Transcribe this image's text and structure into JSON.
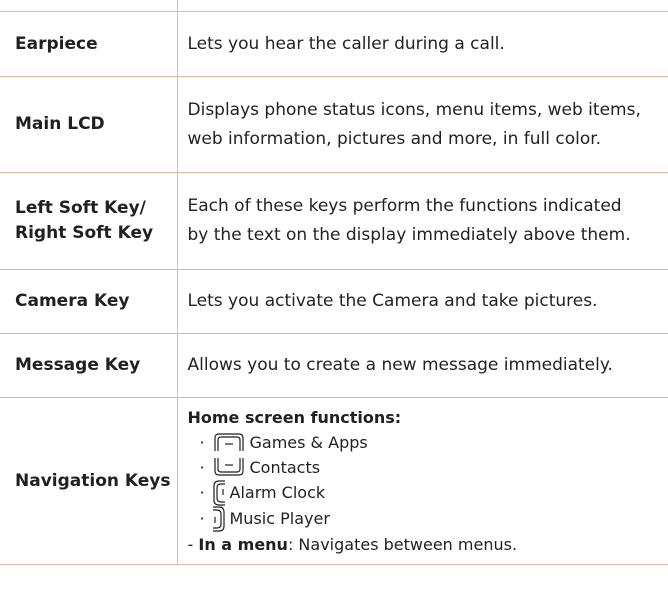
{
  "rows": [
    {
      "key": "Earpiece",
      "desc": "Lets you hear the caller during a call."
    },
    {
      "key": "Main LCD",
      "desc_lines": [
        "Displays phone status icons, menu items, web items,",
        "web information, pictures and more, in full color."
      ]
    },
    {
      "key_lines": [
        "Left Soft Key/",
        "Right Soft Key"
      ],
      "desc_lines": [
        "Each of these keys perform the functions indicated",
        "by the text on the display immediately above them."
      ]
    },
    {
      "key": "Camera Key",
      "desc": "Lets you activate the Camera and take pictures."
    },
    {
      "key": "Message Key",
      "desc": "Allows you to create a new message immediately."
    },
    {
      "key": "Navigation Keys",
      "heading": "Home screen functions:",
      "items": [
        {
          "bullet": "·",
          "icon": "nav-up-key-icon",
          "label": "Games & Apps"
        },
        {
          "bullet": "·",
          "icon": "nav-down-key-icon",
          "label": "Contacts"
        },
        {
          "bullet": "·",
          "icon": "nav-left-key-icon",
          "label": "Alarm Clock"
        },
        {
          "bullet": "·",
          "icon": "nav-right-key-icon",
          "label": "Music Player"
        }
      ],
      "footer_prefix": "- ",
      "footer_bold": "In a menu",
      "footer_rest": ": Navigates between menus."
    }
  ],
  "colors": {
    "rule": "#e2b9a0",
    "text": "#231f20"
  }
}
